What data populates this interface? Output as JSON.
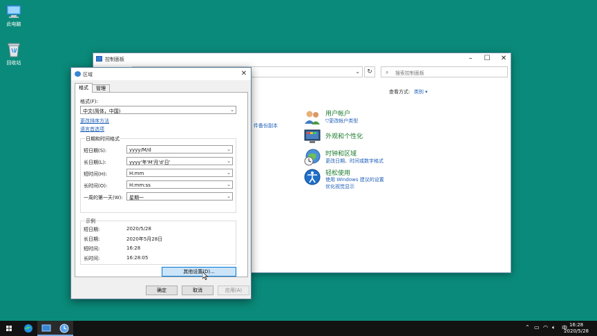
{
  "desktop": {
    "icons": [
      {
        "label": "此电脑",
        "icon": "computer-icon"
      },
      {
        "label": "回收站",
        "icon": "recycle-bin-icon"
      }
    ]
  },
  "control_panel": {
    "title": "控制面板",
    "search_placeholder": "搜索控制面板",
    "view_by_label": "查看方式:",
    "view_by_value": "类别",
    "partial_link": "件备份副本",
    "categories": [
      {
        "title": "用户帐户",
        "links": [
          "更改帐户类型"
        ],
        "icon": "user-accounts-icon"
      },
      {
        "title": "外观和个性化",
        "links": [],
        "icon": "appearance-icon"
      },
      {
        "title": "时钟和区域",
        "links": [
          "更改日期、时间或数字格式"
        ],
        "icon": "clock-region-icon"
      },
      {
        "title": "轻松使用",
        "links": [
          "使用 Windows 建议的设置",
          "优化视觉显示"
        ],
        "icon": "ease-of-access-icon"
      }
    ]
  },
  "region_dialog": {
    "title": "区域",
    "tabs": [
      {
        "label": "格式",
        "active": true
      },
      {
        "label": "管理",
        "active": false
      }
    ],
    "format_label": "格式(F):",
    "format_value": "中文(简体，中国)",
    "link_sort": "更改排序方法",
    "link_lang": "语言首选项",
    "datetime_group_title": "日期和时间格式",
    "fields": [
      {
        "label": "短日期(S):",
        "value": "yyyy/M/d"
      },
      {
        "label": "长日期(L):",
        "value": "yyyy'年'M'月'd'日'"
      },
      {
        "label": "短时间(H):",
        "value": "H:mm"
      },
      {
        "label": "长时间(O):",
        "value": "H:mm:ss"
      },
      {
        "label": "一周的第一天(W):",
        "value": "星期一"
      }
    ],
    "examples_title": "示例",
    "examples": [
      {
        "label": "短日期:",
        "value": "2020/5/28"
      },
      {
        "label": "长日期:",
        "value": "2020年5月28日"
      },
      {
        "label": "短时间:",
        "value": "16:28"
      },
      {
        "label": "长时间:",
        "value": "16:28:05"
      }
    ],
    "other_settings": "其他设置(D)...",
    "ok": "确定",
    "cancel": "取消",
    "apply": "应用(A)"
  },
  "taskbar": {
    "input_method": "中",
    "time": "16:28",
    "date": "2020/5/28"
  }
}
